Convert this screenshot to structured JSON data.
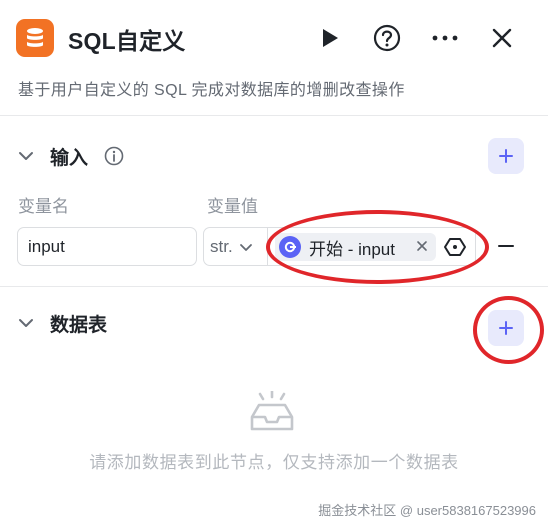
{
  "header": {
    "title": "SQL自定义",
    "description": "基于用户自定义的 SQL 完成对数据库的增删改查操作",
    "icons": {
      "app": "database-icon",
      "run": "play-icon",
      "help": "help-icon",
      "more": "more-icon",
      "close": "close-icon"
    }
  },
  "input_section": {
    "title": "输入",
    "info_icon": "info-icon",
    "add_icon": "plus-icon",
    "col_name": "变量名",
    "col_value": "变量值",
    "row": {
      "name": "input",
      "type": "str.",
      "ref_text": "开始 - input",
      "ref_close": "×"
    }
  },
  "table_section": {
    "title": "数据表",
    "add_icon": "plus-icon",
    "empty_text": "请添加数据表到此节点，仅支持添加一个数据表"
  },
  "watermark": "掘金技术社区 @ user5838167523996",
  "colors": {
    "accent": "#5b63f5",
    "app_icon": "#f27224",
    "annotation": "#e0262a"
  }
}
